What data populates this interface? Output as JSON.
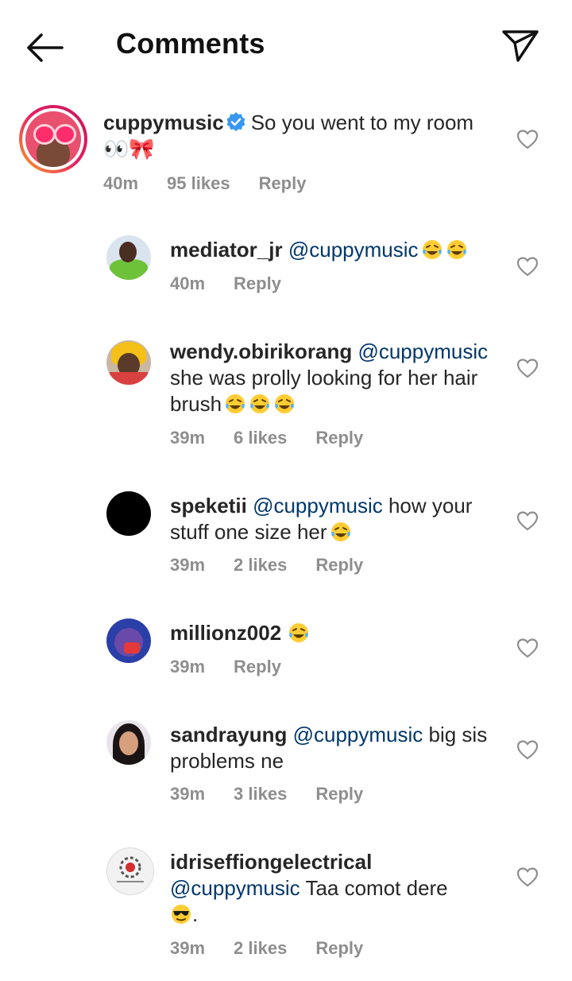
{
  "header": {
    "title": "Comments"
  },
  "main_comment": {
    "username": "cuppymusic",
    "text": "So you went to my room 👀🎀",
    "time": "40m",
    "likes": "95 likes",
    "reply": "Reply"
  },
  "replies": [
    {
      "username": "mediator_jr",
      "mention": "@cuppymusic",
      "text": "",
      "time": "40m",
      "likes": "",
      "reply": "Reply"
    },
    {
      "username": "wendy.obirikorang",
      "mention": "@cuppymusic",
      "text": "she was prolly looking for her hair brush",
      "time": "39m",
      "likes": "6 likes",
      "reply": "Reply"
    },
    {
      "username": "speketii",
      "mention": "@cuppymusic",
      "text": "how your stuff one size her",
      "time": "39m",
      "likes": "2 likes",
      "reply": "Reply"
    },
    {
      "username": "millionz002",
      "mention": "",
      "text": "",
      "time": "39m",
      "likes": "",
      "reply": "Reply"
    },
    {
      "username": "sandrayung",
      "mention": "@cuppymusic",
      "text": "big sis problems ne",
      "time": "39m",
      "likes": "3 likes",
      "reply": "Reply"
    },
    {
      "username": "idriseffiongelectrical",
      "mention": "@cuppymusic",
      "text": "Taa comot dere",
      "trail": ".",
      "time": "39m",
      "likes": "2 likes",
      "reply": "Reply"
    }
  ],
  "colors": {
    "mention": "#00376b",
    "verified": "#3897f0",
    "meta": "#8e8e8e"
  }
}
